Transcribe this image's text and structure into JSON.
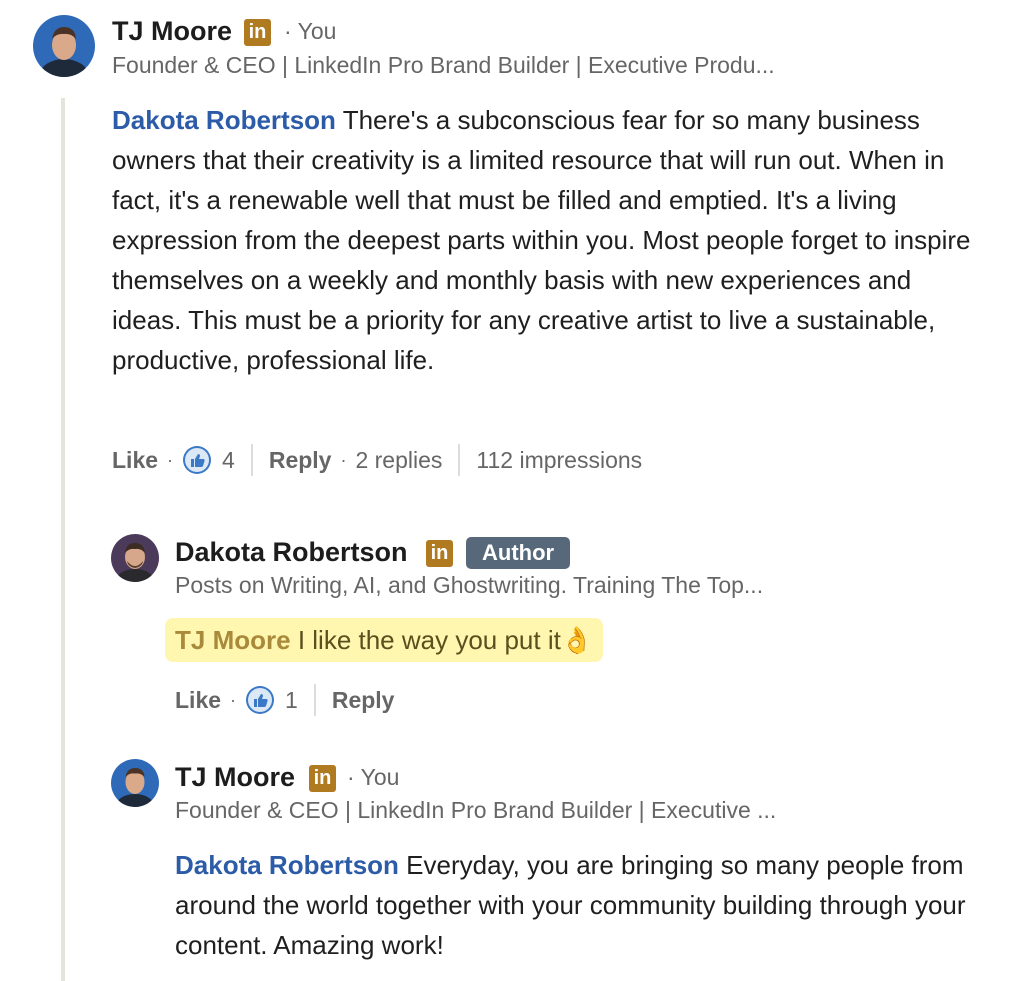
{
  "comment": {
    "author": "TJ Moore",
    "you_label": "You",
    "headline": "Founder & CEO | LinkedIn Pro Brand Builder | Executive Produ...",
    "mention": "Dakota Robertson",
    "text": "There's a subconscious fear for so many business owners that their creativity is a limited resource that will run out. When in fact, it's a renewable well that must be filled and emptied. It's a living expression from the deepest parts within you. Most people forget to inspire themselves on a weekly and monthly basis with new experiences and ideas. This must be a priority for any creative artist to live a sustainable, productive, professional life.",
    "like_label": "Like",
    "like_count": "4",
    "reply_label": "Reply",
    "replies_count": "2 replies",
    "impressions": "112 impressions"
  },
  "reply1": {
    "author": "Dakota Robertson",
    "author_badge": "Author",
    "headline": "Posts on Writing, AI, and Ghostwriting. Training The Top...",
    "mention": "TJ Moore",
    "text": "I like the way you put it👌",
    "like_label": "Like",
    "like_count": "1",
    "reply_label": "Reply"
  },
  "reply2": {
    "author": "TJ Moore",
    "you_label": "You",
    "headline": "Founder & CEO | LinkedIn Pro Brand Builder | Executive ...",
    "mention": "Dakota Robertson",
    "text": "Everyday, you are bringing so many people from around the world together with your community building through your content. Amazing work!"
  },
  "icons": {
    "linkedin_badge": "in",
    "reaction": "like-icon",
    "separator_dot": "·"
  },
  "colors": {
    "mention": "#2c5ba8",
    "linkedin_badge": "#b07a21",
    "author_badge": "#56687a",
    "highlight": "#fff6b0"
  }
}
